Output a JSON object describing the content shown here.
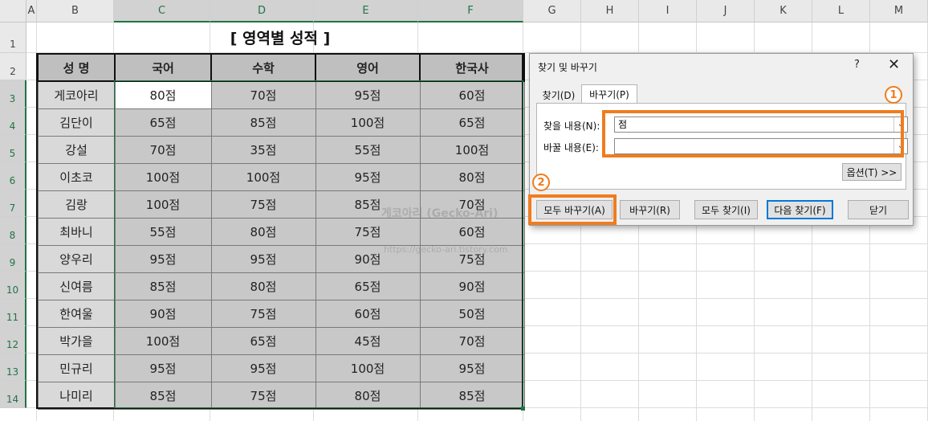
{
  "columns": [
    "A",
    "B",
    "C",
    "D",
    "E",
    "F",
    "G",
    "H",
    "I",
    "J",
    "K",
    "L",
    "M"
  ],
  "rows": [
    "1",
    "2",
    "3",
    "4",
    "5",
    "6",
    "7",
    "8",
    "9",
    "10",
    "11",
    "12",
    "13",
    "14"
  ],
  "title": "[ 영역별 성적 ]",
  "table": {
    "headers": [
      "성 명",
      "국어",
      "수학",
      "영어",
      "한국사"
    ],
    "rows": [
      [
        "게코아리",
        "80점",
        "70점",
        "95점",
        "60점"
      ],
      [
        "김단이",
        "65점",
        "85점",
        "100점",
        "65점"
      ],
      [
        "강설",
        "70점",
        "35점",
        "55점",
        "100점"
      ],
      [
        "이초코",
        "100점",
        "100점",
        "95점",
        "80점"
      ],
      [
        "김랑",
        "100점",
        "75점",
        "85점",
        "70점"
      ],
      [
        "최바니",
        "55점",
        "80점",
        "75점",
        "60점"
      ],
      [
        "양우리",
        "95점",
        "95점",
        "90점",
        "75점"
      ],
      [
        "신여름",
        "85점",
        "80점",
        "65점",
        "90점"
      ],
      [
        "한여울",
        "90점",
        "75점",
        "60점",
        "50점"
      ],
      [
        "박가을",
        "100점",
        "65점",
        "45점",
        "70점"
      ],
      [
        "민규리",
        "95점",
        "95점",
        "100점",
        "95점"
      ],
      [
        "나미리",
        "85점",
        "75점",
        "80점",
        "85점"
      ]
    ]
  },
  "watermark": {
    "line1": "게코아리 (Gecko-Ari)",
    "line2": "https://gecko-ari.tistory.com"
  },
  "dialog": {
    "title": "찾기 및 바꾸기",
    "help": "?",
    "close": "✕",
    "tab_find": "찾기(D)",
    "tab_replace": "바꾸기(P)",
    "find_label": "찾을 내용(N):",
    "find_value": "점",
    "replace_label": "바꿀 내용(E):",
    "replace_value": "",
    "options_btn": "옵션(T) >>",
    "replace_all_btn": "모두 바꾸기(A)",
    "replace_btn": "바꾸기(R)",
    "find_all_btn": "모두 찾기(I)",
    "find_next_btn": "다음 찾기(F)",
    "close_btn": "닫기"
  },
  "callouts": {
    "one": "1",
    "two": "2"
  },
  "colors": {
    "highlight": "#f07c1e",
    "selection": "#217346",
    "primary_button": "#0078d7"
  }
}
